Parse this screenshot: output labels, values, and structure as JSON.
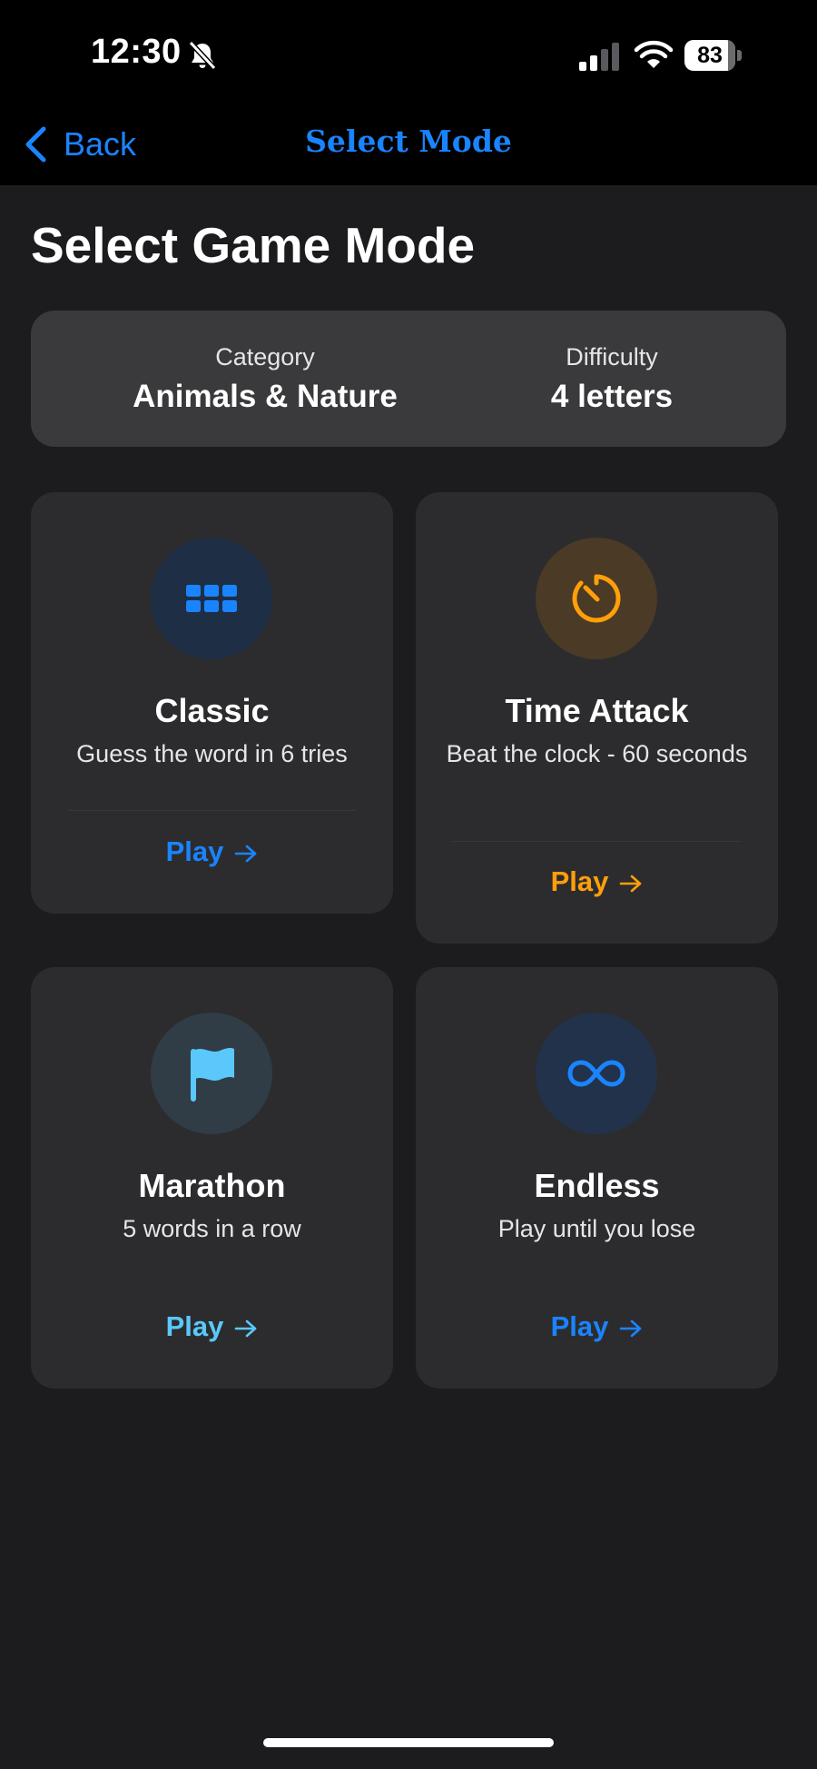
{
  "status_bar": {
    "time": "12:30",
    "battery": "83",
    "icons": [
      "bell-slash-icon",
      "cellular-signal-icon",
      "wifi-icon",
      "battery-icon"
    ]
  },
  "nav": {
    "back_label": "Back",
    "title": "Select Mode"
  },
  "page": {
    "title": "Select Game Mode"
  },
  "info": {
    "category_label": "Category",
    "category_value": "Animals & Nature",
    "difficulty_label": "Difficulty",
    "difficulty_value": "4 letters"
  },
  "modes": [
    {
      "name": "Classic",
      "description": "Guess the word in 6 tries",
      "play_label": "Play",
      "icon": "grid-icon",
      "accent": "#1a84ff",
      "icon_bg": "#1e2f45"
    },
    {
      "name": "Time Attack",
      "description": "Beat the clock - 60 seconds",
      "play_label": "Play",
      "icon": "timer-icon",
      "accent": "#ff9f0a",
      "icon_bg": "#4a3a26"
    },
    {
      "name": "Marathon",
      "description": "5 words in a row",
      "play_label": "Play",
      "icon": "flag-icon",
      "accent": "#5ac8fa",
      "icon_bg": "#303c46"
    },
    {
      "name": "Endless",
      "description": "Play until you lose",
      "play_label": "Play",
      "icon": "infinity-icon",
      "accent": "#1a84ff",
      "icon_bg": "#22324a"
    }
  ]
}
